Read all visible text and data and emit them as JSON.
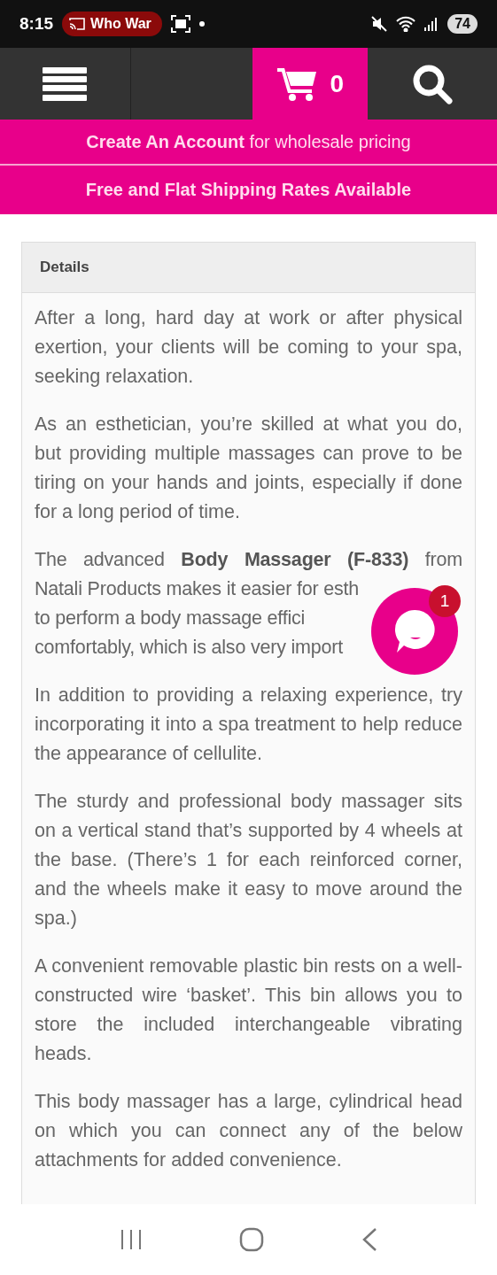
{
  "status_bar": {
    "time": "8:15",
    "cast_pill": "Who War",
    "battery": "74"
  },
  "header": {
    "cart_count": "0"
  },
  "banners": [
    {
      "text": "**Create An Account** for wholesale pricing",
      "bold": false
    },
    {
      "text": "Free and Flat Shipping Rates Available",
      "bold": true
    }
  ],
  "details": {
    "title": "Details",
    "paragraphs": [
      "After a long, hard day at work or after physical exertion, your clients will be coming to your spa, seeking relaxation.",
      "As an esthetician, you’re skilled at what you do, but providing multiple massages can prove to be tiring on your hands and joints, especially if done for a long period of time.",
      {
        "kind": "covered",
        "lines": [
          "The advanced **Body Massager (F-833)** from",
          "Natali Products makes it easier for esth",
          "to perform a body massage effici",
          "comfortably, which is also very import"
        ]
      },
      "In addition to providing a relaxing experience, try incorporating it into a spa treatment to help reduce the appearance of cellulite.",
      "The sturdy and professional body massager sits on a vertical stand that’s supported by 4 wheels at the base. (There’s 1 for each reinforced corner, and the wheels make it easy to move around the spa.)",
      "A convenient removable plastic bin rests on a well-constructed wire ‘basket’. This bin allows you to store the included interchangeable vibrating heads.",
      "This body massager has a large, cylindrical head on which you can connect any of the below attachments for added convenience."
    ]
  },
  "chat": {
    "badge": "1"
  }
}
